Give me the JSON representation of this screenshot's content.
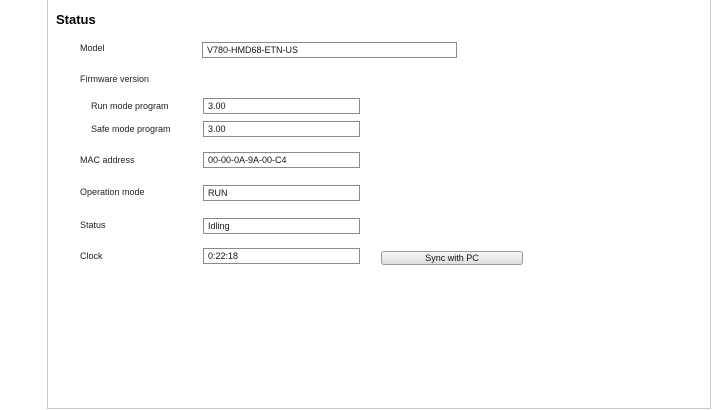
{
  "section": {
    "title": "Status"
  },
  "fields": {
    "model": {
      "label": "Model",
      "value": "V780-HMD68-ETN-US"
    },
    "firmware": {
      "label": "Firmware version"
    },
    "run_mode": {
      "label": "Run mode program",
      "value": "3.00"
    },
    "safe_mode": {
      "label": "Safe mode program",
      "value": "3.00"
    },
    "mac": {
      "label": "MAC address",
      "value": "00-00-0A-9A-00-C4"
    },
    "operation_mode": {
      "label": "Operation mode",
      "value": "RUN"
    },
    "status": {
      "label": "Status",
      "value": "Idling"
    },
    "clock": {
      "label": "Clock",
      "value": "0:22:18"
    }
  },
  "actions": {
    "sync_label": "Sync with PC"
  }
}
